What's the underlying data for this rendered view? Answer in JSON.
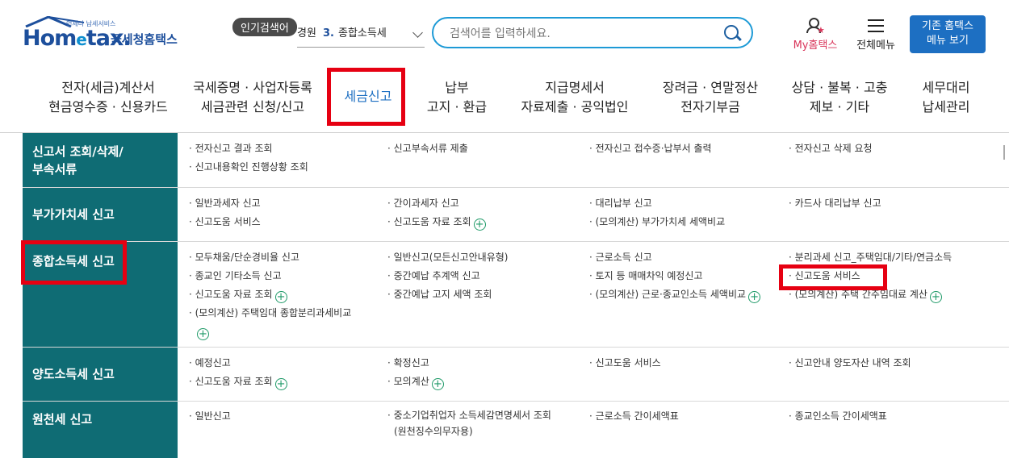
{
  "header": {
    "logo_sub": "언제나 납세서비스",
    "logo_word_1": "Hom",
    "logo_word_e": "e",
    "logo_word_2": "tax.",
    "logo_kr": "국세청홈택스",
    "popular_badge": "인기검색어",
    "popular_prefix": "경원",
    "popular_num": "3.",
    "popular_term": "종합소득세",
    "search_placeholder": "검색어를 입력하세요.",
    "my_label": "My홈택스",
    "menu_label": "전체메뉴",
    "old_home_line1": "기존 홈택스",
    "old_home_line2": "메뉴 보기",
    "colors": {
      "brand": "#1d4f9c",
      "accent": "#1d9ad6",
      "teal": "#0f6c74",
      "highlight": "#e60012",
      "my": "#d9365b"
    }
  },
  "nav": [
    {
      "l1": "전자(세금)계산서",
      "l2": "현금영수증 · 신용카드"
    },
    {
      "l1": "국세증명 · 사업자등록",
      "l2": "세금관련 신청/신고"
    },
    {
      "l1": "세금신고",
      "l2": ""
    },
    {
      "l1": "납부",
      "l2": "고지 · 환급"
    },
    {
      "l1": "지급명세서",
      "l2": "자료제출 · 공익법인"
    },
    {
      "l1": "장려금 · 연말정산",
      "l2": "전자기부금"
    },
    {
      "l1": "상담 · 불복 · 고충",
      "l2": "제보 · 기타"
    },
    {
      "l1": "세무대리",
      "l2": "납세관리"
    }
  ],
  "rows": [
    {
      "head1": "신고서 조회/삭제/",
      "head2": "부속서류",
      "cells": [
        [
          "· 전자신고 결과 조회",
          "· 신고내용확인 진행상황 조회"
        ],
        [
          "· 신고부속서류 제출"
        ],
        [
          "· 전자신고 접수증·납부서 출력"
        ],
        [
          "· 전자신고 삭제 요청"
        ]
      ]
    },
    {
      "head1": "부가가치세 신고",
      "head2": "",
      "cells": [
        [
          "· 일반과세자 신고",
          "· 신고도움 서비스"
        ],
        [
          "· 간이과세자 신고",
          "· 신고도움 자료 조회"
        ],
        [
          "· 대리납부 신고",
          "· (모의계산) 부가가치세 세액비교"
        ],
        [
          "· 카드사 대리납부 신고"
        ]
      ]
    },
    {
      "head1": "종합소득세 신고",
      "head2": "",
      "cells": [
        [
          "· 모두채움/단순경비율 신고",
          "· 종교인 기타소득 신고",
          "· 신고도움 자료 조회",
          "· (모의계산) 주택임대 종합분리과세비교"
        ],
        [
          "· 일반신고(모든신고안내유형)",
          "· 중간예납 추계액 신고",
          "· 중간예납 고지 세액 조회"
        ],
        [
          "· 근로소득 신고",
          "· 토지 등 매매차익 예정신고",
          "· (모의계산) 근로·종교인소득 세액비교"
        ],
        [
          "· 분리과세 신고_주택임대/기타/연금소득",
          "· 신고도움 서비스",
          "· (모의계산) 주택 간주임대료 계산"
        ]
      ]
    },
    {
      "head1": "양도소득세 신고",
      "head2": "",
      "cells": [
        [
          "· 예정신고",
          "· 신고도움 자료 조회"
        ],
        [
          "· 확정신고",
          "· 모의계산"
        ],
        [
          "· 신고도움 서비스"
        ],
        [
          "· 신고안내 양도자산 내역 조회"
        ]
      ]
    },
    {
      "head1": "원천세 신고",
      "head2": "",
      "cells": [
        [
          "· 일반신고"
        ],
        [
          "· 중소기업취업자 소득세감면명세서 조회",
          "(원천징수의무자용)"
        ],
        [
          "· 근로소득 간이세액표"
        ],
        [
          "· 종교인소득 간이세액표"
        ]
      ]
    }
  ]
}
